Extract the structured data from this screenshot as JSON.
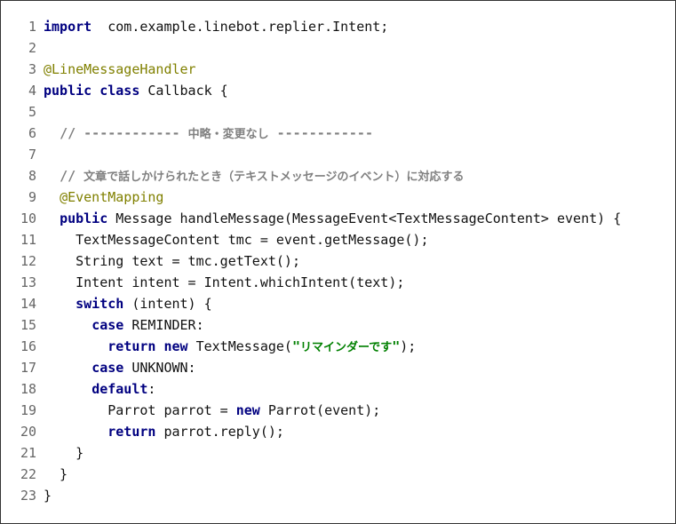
{
  "lines": [
    {
      "n": "1",
      "parts": [
        [
          "kw",
          "import"
        ],
        [
          "",
          "  com.example.linebot.replier.Intent;"
        ]
      ]
    },
    {
      "n": "2",
      "parts": []
    },
    {
      "n": "3",
      "parts": [
        [
          "ann",
          "@LineMessageHandler"
        ]
      ]
    },
    {
      "n": "4",
      "parts": [
        [
          "kw",
          "public"
        ],
        [
          "",
          " "
        ],
        [
          "kw",
          "class"
        ],
        [
          "",
          " Callback {"
        ]
      ]
    },
    {
      "n": "5",
      "parts": []
    },
    {
      "n": "6",
      "parts": [
        [
          "",
          "  "
        ],
        [
          "cmt",
          "// ------------ 中略・変更なし ------------"
        ]
      ]
    },
    {
      "n": "7",
      "parts": []
    },
    {
      "n": "8",
      "parts": [
        [
          "",
          "  "
        ],
        [
          "cmt",
          "// 文章で話しかけられたとき（テキストメッセージのイベント）に対応する"
        ]
      ]
    },
    {
      "n": "9",
      "parts": [
        [
          "",
          "  "
        ],
        [
          "ann",
          "@EventMapping"
        ]
      ]
    },
    {
      "n": "10",
      "parts": [
        [
          "",
          "  "
        ],
        [
          "kw",
          "public"
        ],
        [
          "",
          " Message handleMessage(MessageEvent<TextMessageContent> event) {"
        ]
      ]
    },
    {
      "n": "11",
      "parts": [
        [
          "",
          "    TextMessageContent tmc = event.getMessage();"
        ]
      ]
    },
    {
      "n": "12",
      "parts": [
        [
          "",
          "    String text = tmc.getText();"
        ]
      ]
    },
    {
      "n": "13",
      "parts": [
        [
          "",
          "    Intent intent = Intent.whichIntent(text);"
        ]
      ]
    },
    {
      "n": "14",
      "parts": [
        [
          "",
          "    "
        ],
        [
          "kw",
          "switch"
        ],
        [
          "",
          " (intent) {"
        ]
      ]
    },
    {
      "n": "15",
      "parts": [
        [
          "",
          "      "
        ],
        [
          "kw",
          "case"
        ],
        [
          "",
          " REMINDER:"
        ]
      ]
    },
    {
      "n": "16",
      "parts": [
        [
          "",
          "        "
        ],
        [
          "kw",
          "return"
        ],
        [
          "",
          " "
        ],
        [
          "kw",
          "new"
        ],
        [
          "",
          " TextMessage("
        ],
        [
          "str",
          "\"リマインダーです\""
        ],
        [
          "",
          ");"
        ]
      ]
    },
    {
      "n": "17",
      "parts": [
        [
          "",
          "      "
        ],
        [
          "kw",
          "case"
        ],
        [
          "",
          " UNKNOWN:"
        ]
      ]
    },
    {
      "n": "18",
      "parts": [
        [
          "",
          "      "
        ],
        [
          "kw",
          "default"
        ],
        [
          "",
          ":"
        ]
      ]
    },
    {
      "n": "19",
      "parts": [
        [
          "",
          "        Parrot parrot = "
        ],
        [
          "kw",
          "new"
        ],
        [
          "",
          " Parrot(event);"
        ]
      ]
    },
    {
      "n": "20",
      "parts": [
        [
          "",
          "        "
        ],
        [
          "kw",
          "return"
        ],
        [
          "",
          " parrot.reply();"
        ]
      ]
    },
    {
      "n": "21",
      "parts": [
        [
          "",
          "    }"
        ]
      ]
    },
    {
      "n": "22",
      "parts": [
        [
          "",
          "  }"
        ]
      ]
    },
    {
      "n": "23",
      "parts": [
        [
          "",
          "}"
        ]
      ]
    }
  ]
}
